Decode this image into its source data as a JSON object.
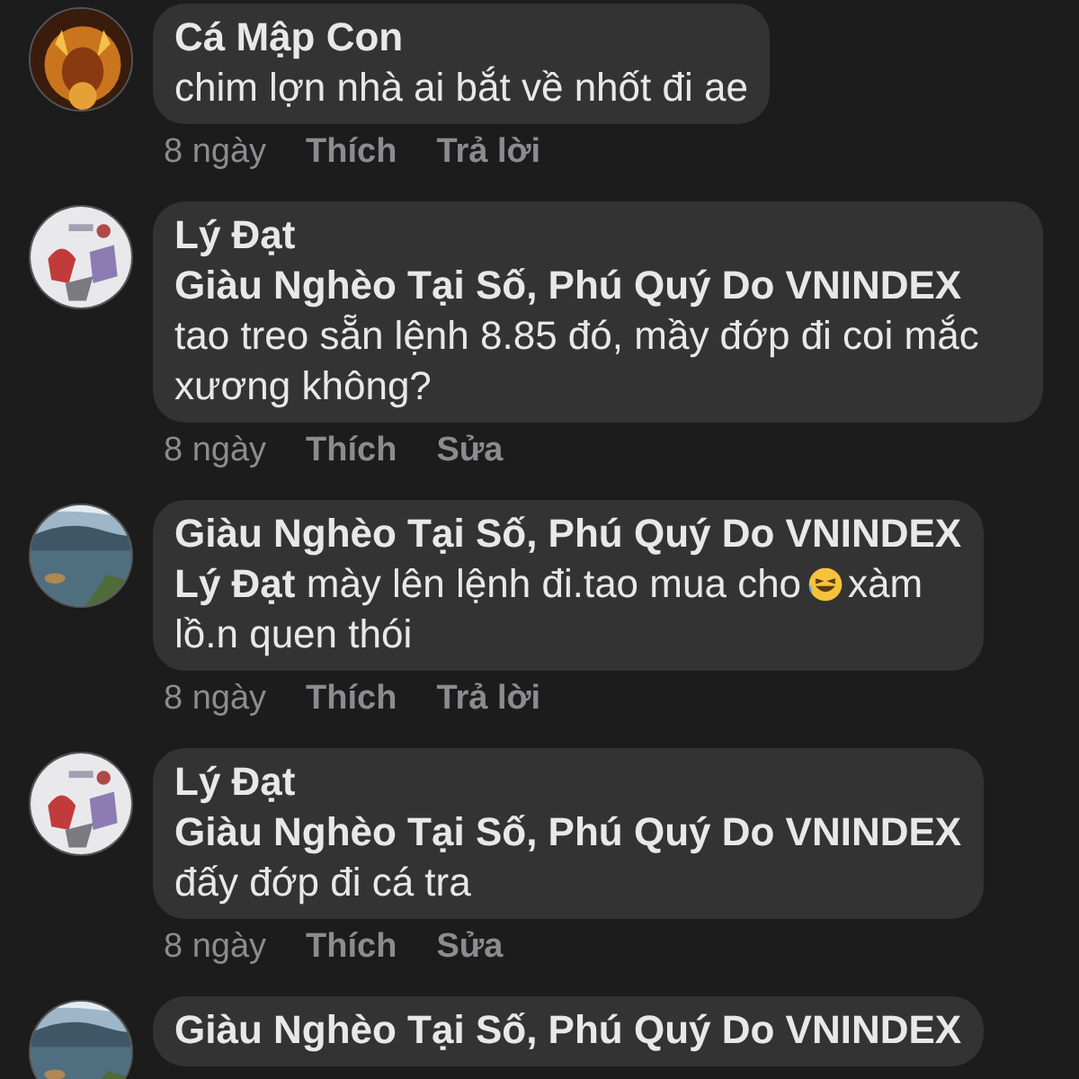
{
  "comments": [
    {
      "author": "Cá Mập Con",
      "avatar": {
        "kind": "picture"
      },
      "body": [
        {
          "kind": "text",
          "text": "chim lợn nhà ai bắt về nhốt đi ae"
        }
      ],
      "actions": [
        {
          "kind": "time",
          "label": "8 ngày"
        },
        {
          "kind": "link",
          "label": "Thích"
        },
        {
          "kind": "link",
          "label": "Trả lời"
        }
      ]
    },
    {
      "author": "Lý Đạt",
      "avatar": {
        "kind": "picture"
      },
      "body": [
        {
          "kind": "mention",
          "text": "Giàu Nghèo Tại Số, Phú Quý Do VNINDEX"
        },
        {
          "kind": "text",
          "text": "tao treo sẵn lệnh 8.85 đó, mầy đớp đi coi mắc xương không?"
        }
      ],
      "actions": [
        {
          "kind": "time",
          "label": "8 ngày"
        },
        {
          "kind": "link",
          "label": "Thích"
        },
        {
          "kind": "link",
          "label": "Sửa"
        }
      ]
    },
    {
      "author": "Giàu Nghèo Tại Số, Phú Quý Do VNINDEX",
      "avatar": {
        "kind": "picture"
      },
      "body": [
        {
          "kind": "inline",
          "parts": [
            {
              "kind": "mention",
              "text": "Lý Đạt"
            },
            {
              "kind": "text",
              "text": "mày lên lệnh đi.tao mua cho"
            },
            {
              "kind": "emoji"
            },
            {
              "kind": "text",
              "text": "xàm"
            }
          ]
        },
        {
          "kind": "text",
          "text": "lồ.n quen thói"
        }
      ],
      "actions": [
        {
          "kind": "time",
          "label": "8 ngày"
        },
        {
          "kind": "link",
          "label": "Thích"
        },
        {
          "kind": "link",
          "label": "Trả lời"
        }
      ]
    },
    {
      "author": "Lý Đạt",
      "avatar": {
        "kind": "picture"
      },
      "body": [
        {
          "kind": "mention",
          "text": "Giàu Nghèo Tại Số, Phú Quý Do VNINDEX"
        },
        {
          "kind": "text",
          "text": "đấy đớp đi cá tra"
        }
      ],
      "actions": [
        {
          "kind": "time",
          "label": "8 ngày"
        },
        {
          "kind": "link",
          "label": "Thích"
        },
        {
          "kind": "link",
          "label": "Sửa"
        }
      ]
    },
    {
      "author": "Giàu Nghèo Tại Số, Phú Quý Do VNINDEX",
      "avatar": {
        "kind": "picture"
      }
    }
  ]
}
